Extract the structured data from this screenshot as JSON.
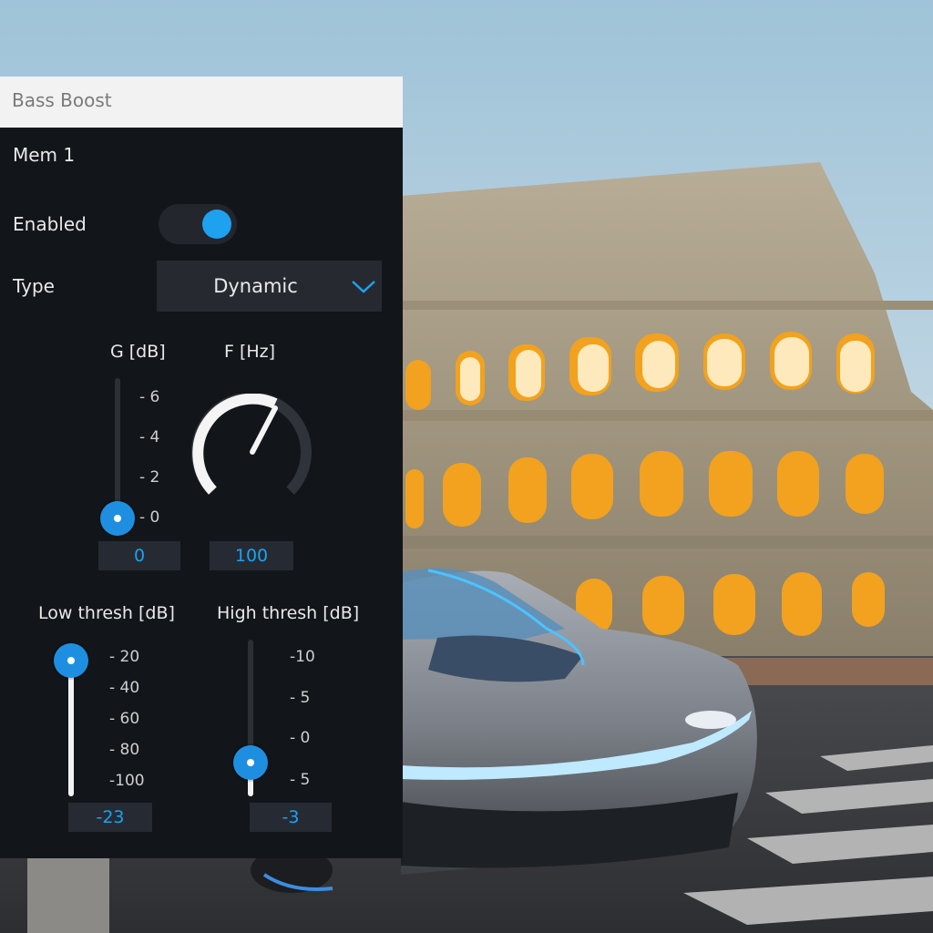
{
  "panel": {
    "title": "Bass Boost",
    "memory": "Mem 1",
    "enabled_label": "Enabled",
    "enabled": true,
    "type_label": "Type",
    "type_value": "Dynamic"
  },
  "gain": {
    "label": "G [dB]",
    "ticks": [
      "6",
      "4",
      "2",
      "0"
    ],
    "value": "0"
  },
  "frequency": {
    "label": "F [Hz]",
    "value": "100"
  },
  "low_thresh": {
    "label": "Low thresh [dB]",
    "ticks": [
      "20",
      "40",
      "60",
      "80",
      "100"
    ],
    "value": "-23"
  },
  "high_thresh": {
    "label": "High thresh [dB]",
    "ticks": [
      "10",
      "5",
      "0",
      "5"
    ],
    "value": "-3"
  },
  "colors": {
    "accent": "#1ea1ef",
    "panel": "#121519",
    "title_bar": "#f2f2f2"
  }
}
